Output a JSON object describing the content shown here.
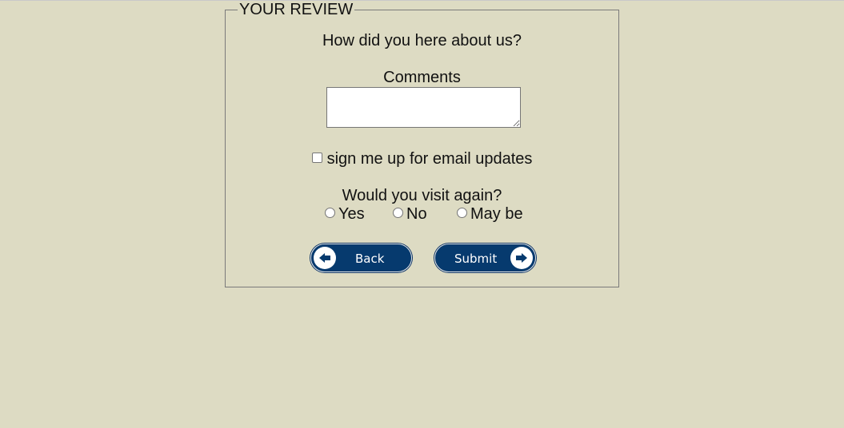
{
  "form": {
    "legend": "YOUR REVIEW",
    "heard_question": "How did you here about us?",
    "comments_label": "Comments",
    "comments_value": "",
    "email_checkbox_label": "sign me up for email updates",
    "email_checked": false,
    "visit_question": "Would you visit again?",
    "visit_options": [
      {
        "label": "Yes",
        "selected": false
      },
      {
        "label": "No",
        "selected": false
      },
      {
        "label": "May be",
        "selected": false
      }
    ],
    "back_label": "Back",
    "submit_label": "Submit"
  },
  "colors": {
    "background": "#dddbc3",
    "button": "#063a6e",
    "border": "#7a7a7a"
  },
  "icons": {
    "back": "arrow-left-circle-icon",
    "submit": "arrow-right-circle-icon"
  }
}
